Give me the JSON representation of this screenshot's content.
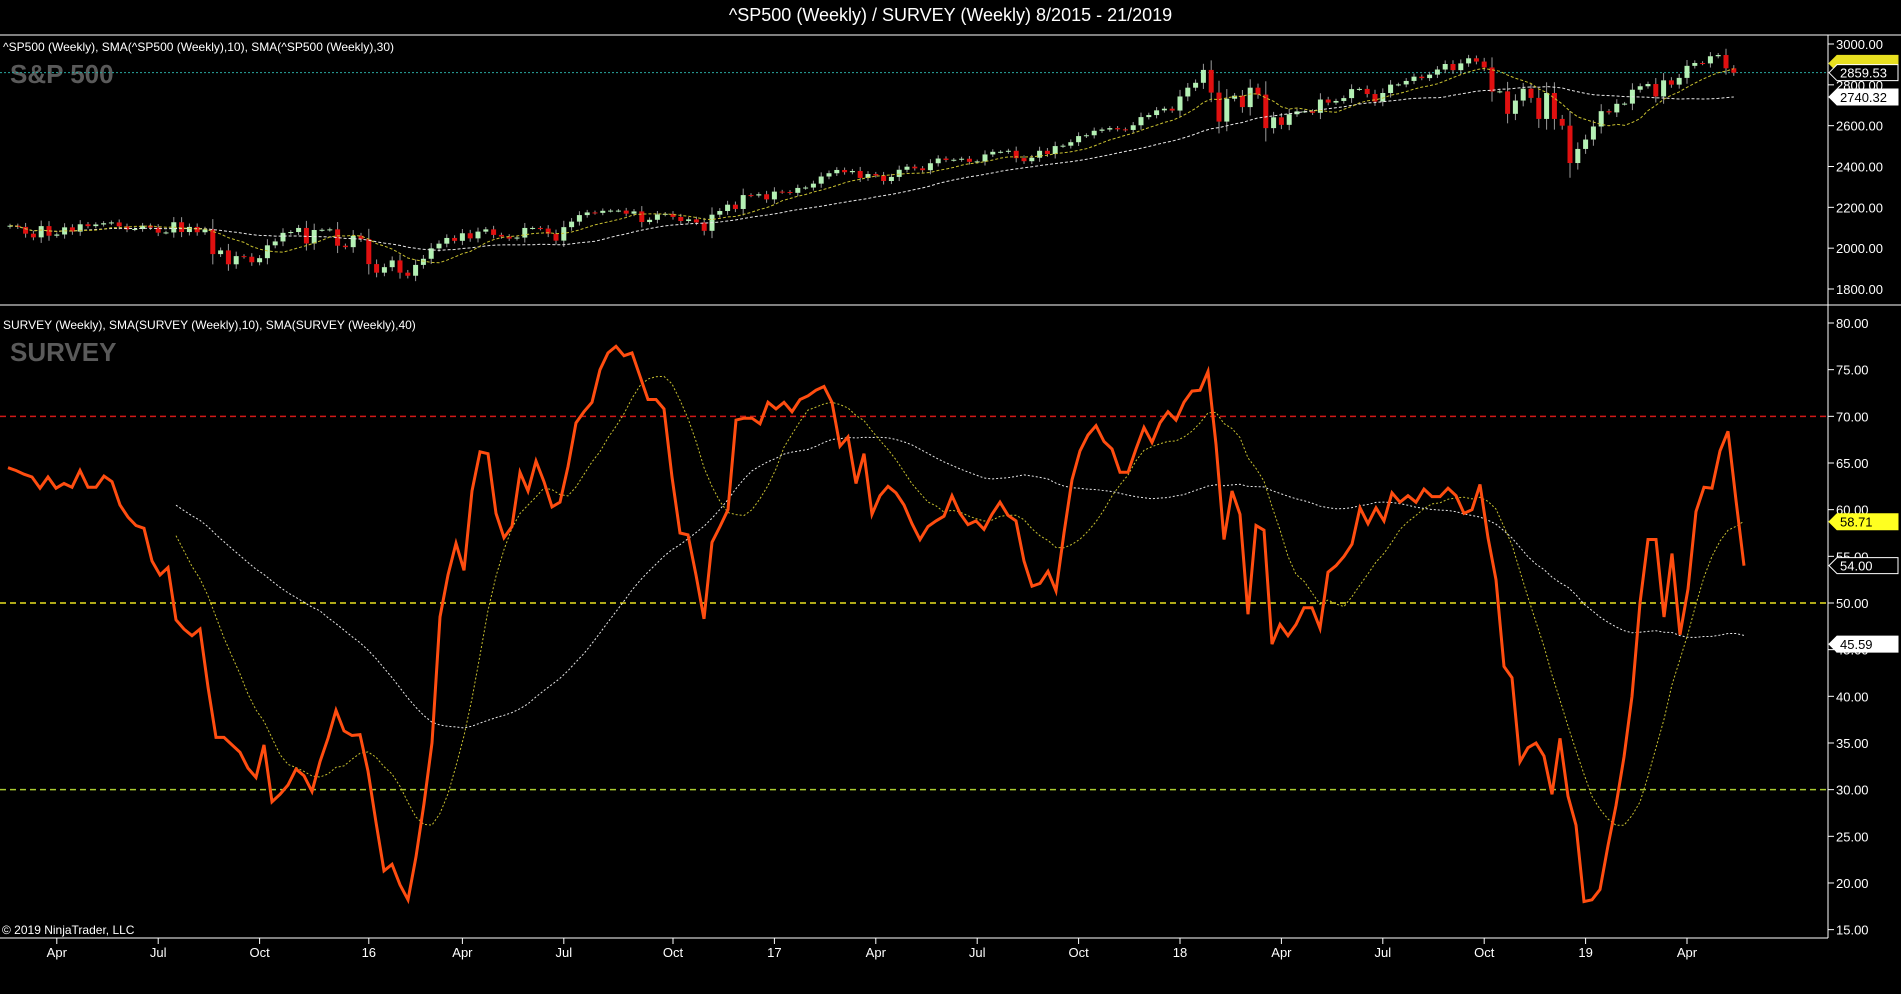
{
  "title": "^SP500 (Weekly) / SURVEY (Weekly)  8/2015 - 21/2019",
  "copyright": "© 2019 NinjaTrader, LLC",
  "colors": {
    "up": "#b4f0b4",
    "down": "#e01010",
    "wick": "#9a9a9a",
    "sma_short": "#c8c030",
    "sma_long": "#e8e8e8",
    "survey": "#ff4d10",
    "last_line": "#2aa8a0",
    "level_70": "#d01818",
    "level_50": "#e8e020",
    "level_30": "#a8c830"
  },
  "chart_data": [
    {
      "type": "candlestick",
      "panel": "top",
      "legend": "^SP500 (Weekly),  SMA(^SP500 (Weekly),10),  SMA(^SP500 (Weekly),30)",
      "watermark": "S&P 500",
      "ylim": [
        1750,
        3030
      ],
      "yticks": [
        "3000.00",
        "2800.00",
        "2600.00",
        "2400.00",
        "2200.00",
        "2000.00",
        "1800.00"
      ],
      "ytick_values": [
        3000,
        2800,
        2600,
        2400,
        2200,
        2000,
        1800
      ],
      "sma_periods": [
        10,
        30
      ],
      "last_value_labels": {
        "close": "2859.53",
        "sma30": "2740.32"
      },
      "last_value_numbers": {
        "close": 2859.53,
        "sma30": 2740.32
      },
      "closes": [
        2110,
        2104,
        2071,
        2053,
        2108,
        2061,
        2067,
        2102,
        2081,
        2117,
        2108,
        2116,
        2122,
        2126,
        2107,
        2092,
        2094,
        2110,
        2101,
        2076,
        2077,
        2127,
        2079,
        2104,
        2078,
        2092,
        1971,
        1989,
        1921,
        1961,
        1958,
        1931,
        1951,
        2014,
        2033,
        2075,
        2079,
        2099,
        2023,
        2089,
        2090,
        2092,
        2012,
        2005,
        2061,
        2044,
        1922,
        1880,
        1907,
        1940,
        1880,
        1865,
        1918,
        1948,
        1999,
        2022,
        2050,
        2036,
        2073,
        2048,
        2081,
        2092,
        2065,
        2057,
        2047,
        2052,
        2099,
        2099,
        2096,
        2071,
        2037,
        2103,
        2130,
        2162,
        2175,
        2173,
        2183,
        2184,
        2184,
        2169,
        2180,
        2128,
        2139,
        2165,
        2168,
        2153,
        2133,
        2141,
        2126,
        2085,
        2164,
        2182,
        2213,
        2192,
        2260,
        2258,
        2264,
        2239,
        2277,
        2275,
        2271,
        2295,
        2297,
        2316,
        2351,
        2367,
        2383,
        2372,
        2378,
        2344,
        2363,
        2356,
        2329,
        2349,
        2384,
        2399,
        2391,
        2382,
        2416,
        2439,
        2432,
        2433,
        2438,
        2423,
        2425,
        2459,
        2472,
        2472,
        2477,
        2441,
        2426,
        2443,
        2477,
        2461,
        2500,
        2502,
        2519,
        2549,
        2553,
        2575,
        2581,
        2588,
        2582,
        2579,
        2602,
        2642,
        2652,
        2675,
        2683,
        2674,
        2743,
        2786,
        2810,
        2873,
        2762,
        2620,
        2732,
        2747,
        2691,
        2786,
        2752,
        2588,
        2641,
        2604,
        2656,
        2670,
        2670,
        2663,
        2728,
        2713,
        2721,
        2735,
        2779,
        2780,
        2755,
        2718,
        2760,
        2801,
        2802,
        2819,
        2840,
        2833,
        2850,
        2875,
        2902,
        2872,
        2905,
        2930,
        2914,
        2885,
        2767,
        2768,
        2658,
        2723,
        2781,
        2736,
        2633,
        2760,
        2633,
        2600,
        2417,
        2486,
        2532,
        2596,
        2671,
        2665,
        2707,
        2708,
        2776,
        2793,
        2804,
        2743,
        2822,
        2801,
        2834,
        2893,
        2907,
        2905,
        2940,
        2946,
        2881,
        2859.53
      ]
    },
    {
      "type": "line",
      "panel": "bottom",
      "legend": "SURVEY (Weekly),  SMA(SURVEY (Weekly),10),  SMA(SURVEY (Weekly),40)",
      "watermark": "SURVEY",
      "ylim": [
        14,
        82
      ],
      "yticks": [
        "80.00",
        "75.00",
        "70.00",
        "65.00",
        "60.00",
        "55.00",
        "50.00",
        "45.00",
        "40.00",
        "35.00",
        "30.00",
        "25.00",
        "20.00",
        "15.00"
      ],
      "ytick_values": [
        80,
        75,
        70,
        65,
        60,
        55,
        50,
        45,
        40,
        35,
        30,
        25,
        20,
        15
      ],
      "reference_lines": [
        70,
        50,
        30
      ],
      "sma_periods": [
        10,
        40
      ],
      "last_value_labels": {
        "sma10": "58.71",
        "value": "54.00",
        "sma40": "45.59"
      },
      "last_value_numbers": {
        "sma10": 58.71,
        "value": 54.0,
        "sma40": 45.59
      },
      "values": [
        64.5,
        64.2,
        63.8,
        63.5,
        62.3,
        63.5,
        62.3,
        62.8,
        62.4,
        64.2,
        62.4,
        62.4,
        63.6,
        63,
        60.5,
        59.2,
        58.3,
        58,
        54.5,
        53,
        53.8,
        48.2,
        47.2,
        46.5,
        47.2,
        41,
        35.6,
        35.6,
        34.8,
        34,
        32.3,
        31.3,
        34.8,
        28.7,
        29.5,
        30.5,
        32.2,
        31.5,
        29.8,
        33,
        35.5,
        38.5,
        36.3,
        35.8,
        35.9,
        32,
        26.5,
        21.3,
        22,
        19.8,
        18.2,
        22.8,
        28.5,
        35,
        48.5,
        53,
        56.4,
        53.5,
        62,
        66.2,
        66,
        59.6,
        57,
        58.2,
        64,
        62,
        65.2,
        63,
        60.3,
        60.8,
        64.6,
        69.3,
        70.5,
        71.5,
        75,
        76.8,
        77.5,
        76.5,
        76.8,
        74.3,
        71.8,
        71.8,
        70.8,
        63.5,
        57.5,
        57.3,
        53,
        48.3,
        56.5,
        58.2,
        60,
        69.6,
        69.8,
        69.8,
        69.2,
        71.5,
        70.8,
        71.5,
        70.5,
        71.8,
        72.2,
        72.8,
        73.2,
        71.5,
        66.8,
        67.8,
        62.8,
        66,
        59.5,
        61.5,
        62.5,
        61.8,
        60.5,
        58.5,
        56.8,
        58.2,
        58.8,
        59.3,
        61.5,
        59.6,
        58.4,
        58.8,
        57.9,
        59.5,
        60.8,
        59.4,
        58.8,
        54.5,
        51.8,
        52.1,
        53.4,
        51.3,
        57.5,
        63.2,
        66.3,
        68,
        69,
        67.3,
        66.5,
        64,
        64,
        66.5,
        68.8,
        67.2,
        69.3,
        70.5,
        69.6,
        71.5,
        72.7,
        72.8,
        74.8,
        67,
        56.8,
        62,
        59.5,
        48.8,
        58.3,
        57.8,
        45.6,
        47.7,
        46.5,
        47.7,
        49.5,
        49.5,
        47.3,
        53.3,
        54,
        55,
        56.3,
        60.2,
        58.5,
        60.2,
        58.8,
        61.8,
        60.8,
        61.5,
        60.8,
        62.2,
        61.4,
        61.4,
        62.3,
        61.5,
        59.6,
        60,
        62.7,
        57,
        52.5,
        43.2,
        42,
        33,
        34.5,
        35,
        33.6,
        29.5,
        35.5,
        29.3,
        26.2,
        18,
        18.2,
        19.3,
        24,
        28.3,
        33.5,
        40,
        50,
        56.8,
        56.8,
        48.5,
        55.3,
        46.6,
        51.5,
        59.8,
        62.4,
        62.3,
        66.3,
        68.4,
        61,
        54
      ]
    }
  ],
  "x_axis": {
    "labels": [
      "Apr",
      "Jul",
      "Oct",
      "16",
      "Apr",
      "Jul",
      "Oct",
      "17",
      "Apr",
      "Jul",
      "Oct",
      "18",
      "Apr",
      "Jul",
      "Oct",
      "19",
      "Apr"
    ],
    "week_index": [
      6,
      19,
      32,
      46,
      58,
      71,
      85,
      98,
      111,
      124,
      137,
      150,
      163,
      176,
      189,
      202,
      215
    ]
  }
}
